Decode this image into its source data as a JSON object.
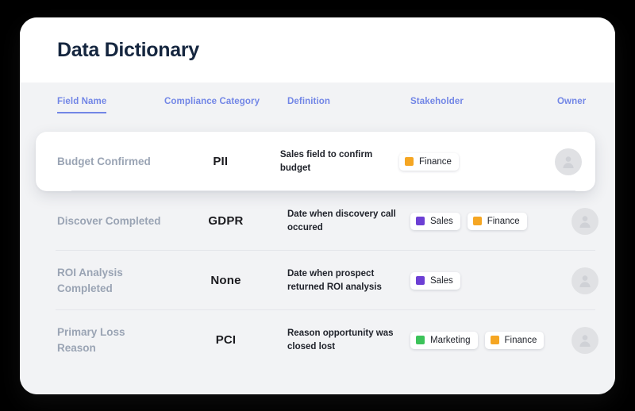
{
  "page": {
    "background_color": "#000000",
    "card_background": "#ffffff",
    "title": "Data Dictionary"
  },
  "table": {
    "header_background": "#f2f3f5",
    "accent_color": "#7286e6",
    "columns": [
      {
        "label": "Field Name",
        "active": true
      },
      {
        "label": "Compliance Category",
        "active": false
      },
      {
        "label": "Definition",
        "active": false
      },
      {
        "label": "Stakeholder",
        "active": false
      },
      {
        "label": "Owner",
        "active": false
      }
    ],
    "rows": [
      {
        "selected": true,
        "field_name": "Budget Confirmed",
        "compliance_category": "PII",
        "definition": "Sales field to confirm budget",
        "stakeholders": [
          {
            "label": "Finance",
            "color": "#f5a623"
          }
        ],
        "owner_icon": "user-avatar-icon"
      },
      {
        "selected": false,
        "field_name": "Discover Completed",
        "compliance_category": "GDPR",
        "definition": "Date when discovery call occured",
        "stakeholders": [
          {
            "label": "Sales",
            "color": "#6c3fd4"
          },
          {
            "label": "Finance",
            "color": "#f5a623"
          }
        ],
        "owner_icon": "user-avatar-icon"
      },
      {
        "selected": false,
        "field_name": "ROI Analysis Completed",
        "compliance_category": "None",
        "definition": "Date when prospect returned ROI analysis",
        "stakeholders": [
          {
            "label": "Sales",
            "color": "#6c3fd4"
          }
        ],
        "owner_icon": "user-avatar-icon"
      },
      {
        "selected": false,
        "field_name": "Primary Loss Reason",
        "compliance_category": "PCI",
        "definition": "Reason opportunity was closed lost",
        "stakeholders": [
          {
            "label": "Marketing",
            "color": "#3cc35a"
          },
          {
            "label": "Finance",
            "color": "#f5a623"
          }
        ],
        "owner_icon": "user-avatar-icon"
      }
    ]
  }
}
